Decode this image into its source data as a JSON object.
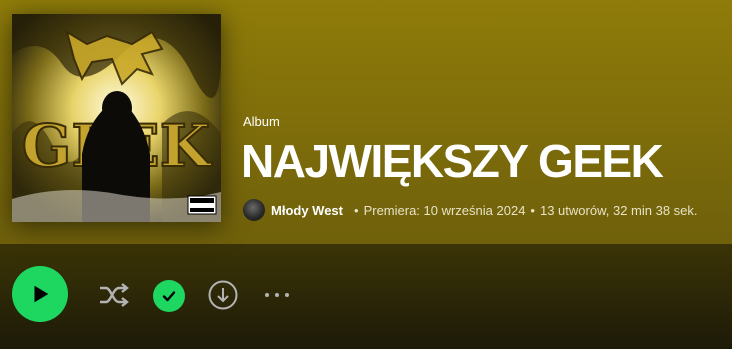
{
  "album": {
    "type_label": "Album",
    "title": "NAJWIĘKSZY GEEK",
    "cover_art_text": "GEEK",
    "advisory_label": "PARENTAL ADVISORY EXPLICIT CONTENT"
  },
  "meta": {
    "artist": "Młody West",
    "separator": "•",
    "release": "Premiera: 10 września 2024",
    "tracks_duration": "13 utworów, 32 min 38 sek."
  },
  "actions": {
    "play_icon": "play-icon",
    "shuffle_icon": "shuffle-icon",
    "saved_icon": "check-icon",
    "download_icon": "download-icon",
    "more_icon": "more-icon"
  },
  "colors": {
    "header_bg": "#8f7c0a",
    "accent": "#1ed760"
  }
}
